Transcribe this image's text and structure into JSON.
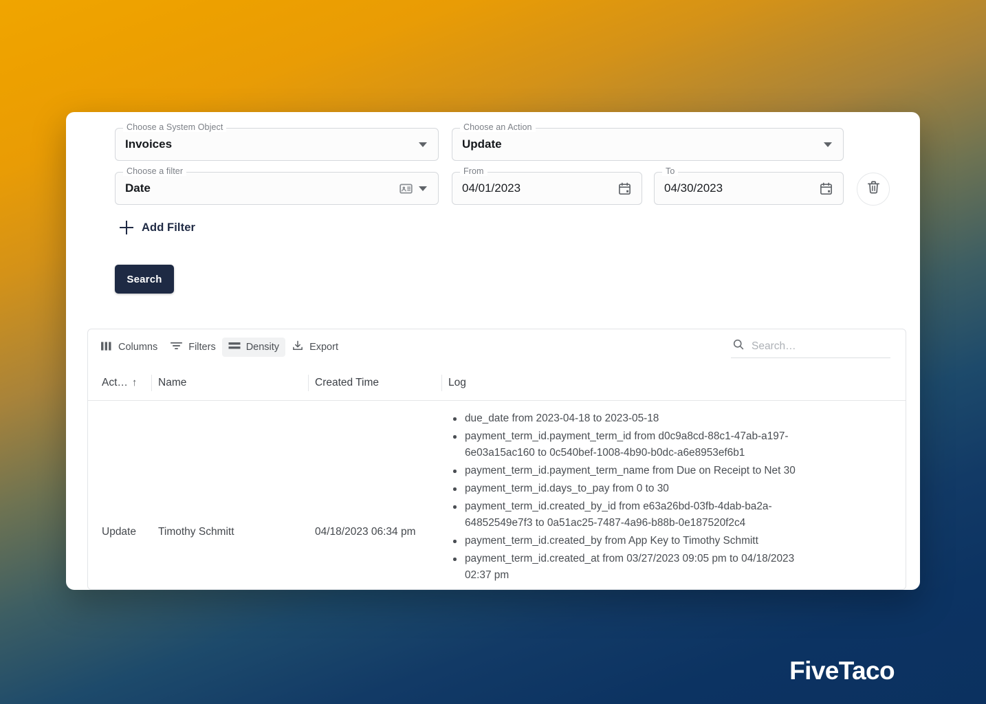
{
  "filters": {
    "system_object": {
      "legend": "Choose a System Object",
      "value": "Invoices"
    },
    "action": {
      "legend": "Choose an Action",
      "value": "Update"
    },
    "filter": {
      "legend": "Choose a filter",
      "value": "Date"
    },
    "from": {
      "legend": "From",
      "value": "04/01/2023"
    },
    "to": {
      "legend": "To",
      "value": "04/30/2023"
    },
    "delete_icon": "trash-icon",
    "add_filter_label": "Add Filter",
    "search_button_label": "Search"
  },
  "toolbar": {
    "columns_label": "Columns",
    "filters_label": "Filters",
    "density_label": "Density",
    "export_label": "Export",
    "search_placeholder": "Search…",
    "search_value": ""
  },
  "grid": {
    "columns": [
      {
        "label": "Act…",
        "sort": "↑"
      },
      {
        "label": "Name"
      },
      {
        "label": "Created Time"
      },
      {
        "label": "Log"
      }
    ],
    "rows": [
      {
        "action": "Update",
        "name": "Timothy Schmitt",
        "created_time": "04/18/2023 06:34 pm",
        "log": [
          "due_date from 2023-04-18 to 2023-05-18",
          "payment_term_id.payment_term_id from d0c9a8cd-88c1-47ab-a197-6e03a15ac160 to 0c540bef-1008-4b90-b0dc-a6e8953ef6b1",
          "payment_term_id.payment_term_name from Due on Receipt to Net 30",
          "payment_term_id.days_to_pay from 0 to 30",
          "payment_term_id.created_by_id from e63a26bd-03fb-4dab-ba2a-64852549e7f3 to 0a51ac25-7487-4a96-b88b-0e187520f2c4",
          "payment_term_id.created_by from App Key to Timothy Schmitt",
          "payment_term_id.created_at from 03/27/2023 09:05 pm to 04/18/2023 02:37 pm"
        ]
      }
    ]
  },
  "branding": {
    "watermark": "FiveTaco"
  },
  "colors": {
    "accent_button": "#1e2a44",
    "background_top": "#f0a500",
    "background_bottom": "#0b3160"
  }
}
